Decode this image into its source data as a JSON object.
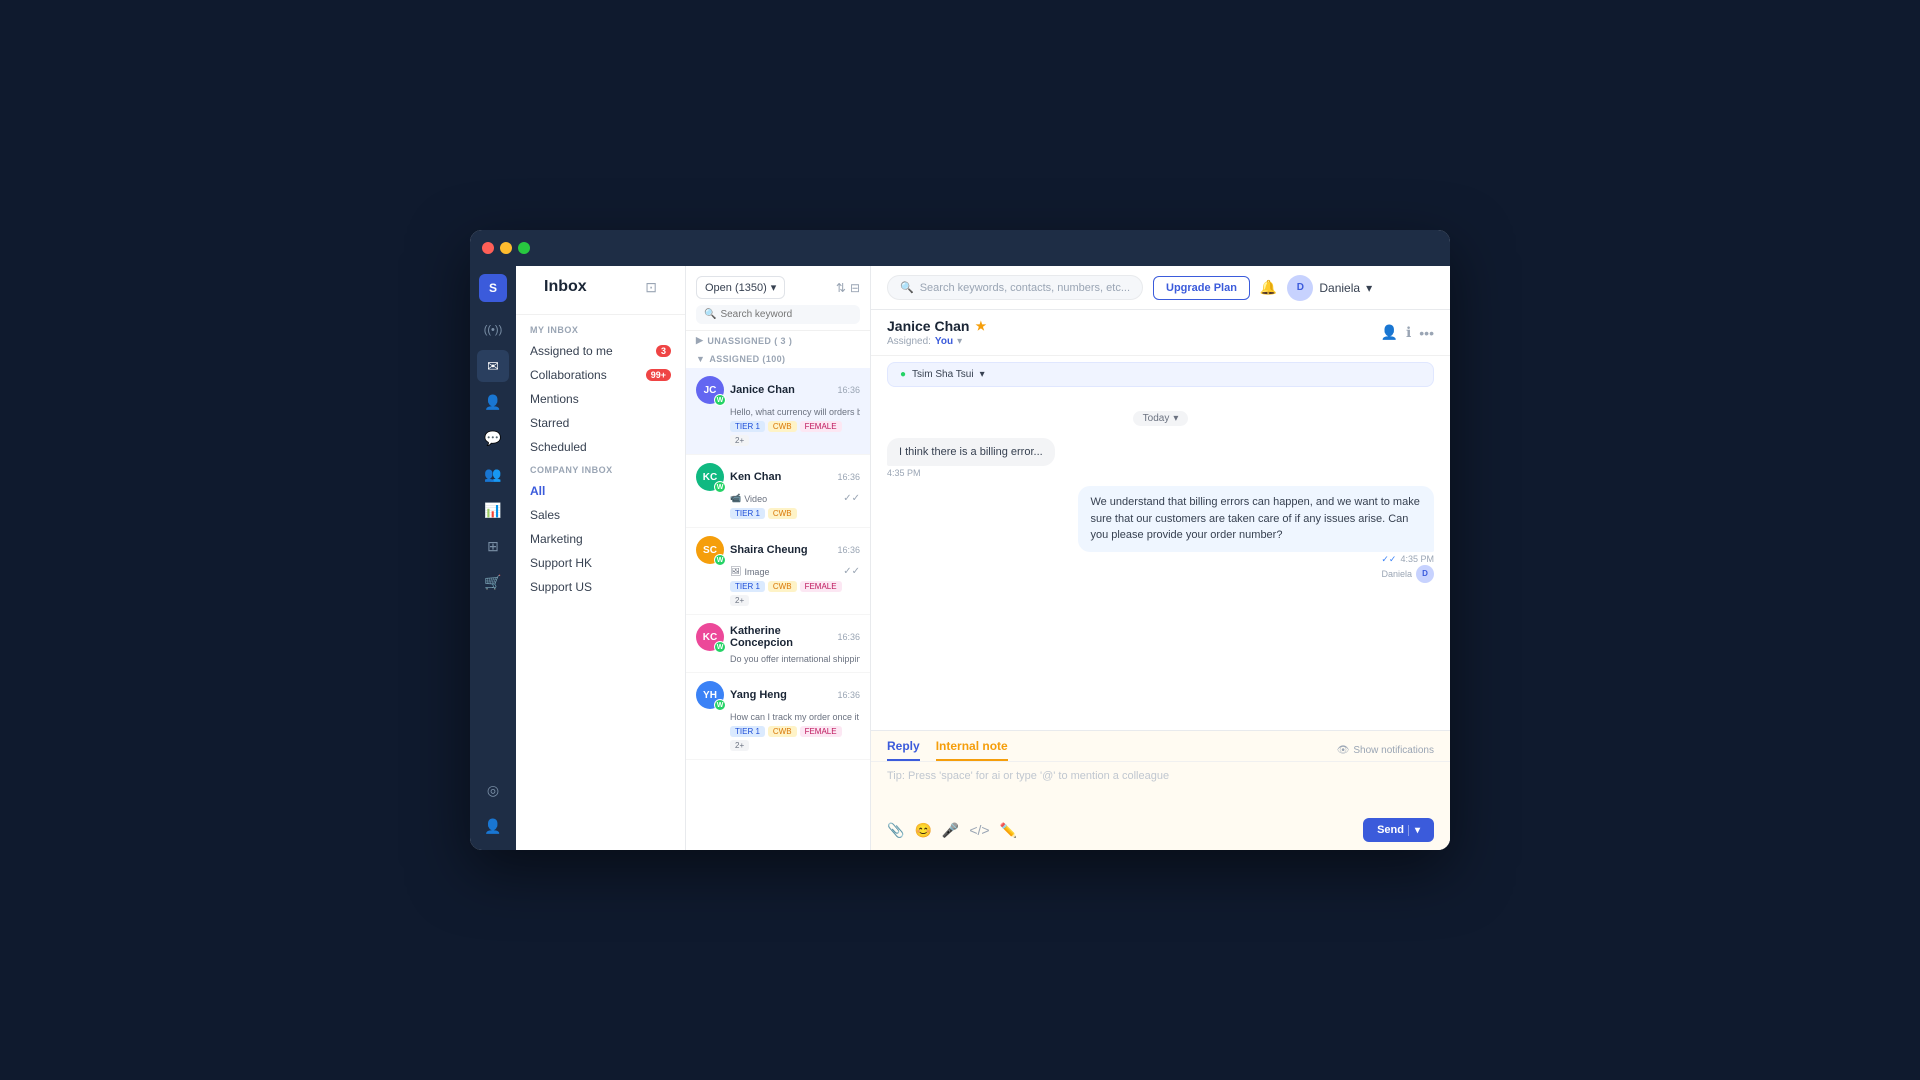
{
  "window": {
    "title": "Inbox"
  },
  "global_header": {
    "search_placeholder": "Search keywords, contacts, numbers, etc...",
    "upgrade_btn": "Upgrade Plan",
    "user_name": "Daniela",
    "bell_icon": "🔔",
    "chevron_icon": "▾"
  },
  "icon_sidebar": {
    "logo": "S",
    "icons": [
      {
        "name": "broadcast-icon",
        "symbol": "((•))",
        "active": false
      },
      {
        "name": "inbox-icon",
        "symbol": "✉",
        "active": true
      },
      {
        "name": "contacts-icon",
        "symbol": "👤",
        "active": false
      },
      {
        "name": "chat-icon",
        "symbol": "💬",
        "active": false
      },
      {
        "name": "team-icon",
        "symbol": "👥",
        "active": false
      },
      {
        "name": "reports-icon",
        "symbol": "📊",
        "active": false
      },
      {
        "name": "settings-icon",
        "symbol": "⚙",
        "active": false
      },
      {
        "name": "shop-icon",
        "symbol": "🛒",
        "active": false
      }
    ],
    "bottom_icons": [
      {
        "name": "circle-icon",
        "symbol": "◎"
      },
      {
        "name": "user-icon",
        "symbol": "👤"
      }
    ]
  },
  "left_panel": {
    "title": "Inbox",
    "my_inbox_label": "MY INBOX",
    "my_inbox_items": [
      {
        "label": "Assigned to me",
        "badge": "3",
        "badge_type": "red"
      },
      {
        "label": "Collaborations",
        "badge": "99+",
        "badge_type": "red"
      },
      {
        "label": "Mentions",
        "badge": null
      },
      {
        "label": "Starred",
        "badge": null
      },
      {
        "label": "Scheduled",
        "badge": null
      }
    ],
    "company_inbox_label": "COMPANY INBOX",
    "company_inbox_items": [
      {
        "label": "All",
        "active": true
      },
      {
        "label": "Sales"
      },
      {
        "label": "Marketing"
      },
      {
        "label": "Support HK"
      },
      {
        "label": "Support US"
      }
    ]
  },
  "conv_panel": {
    "filter_label": "Open (1350)",
    "search_placeholder": "Search keyword",
    "sections": [
      {
        "label": "UNASSIGNED ( 3 )",
        "collapsed": false
      },
      {
        "label": "ASSIGNED (100)",
        "collapsed": false
      }
    ],
    "conversations": [
      {
        "name": "Janice Chan",
        "time": "16:36",
        "preview": "Hello, what currency will orders be settled in?",
        "avatar_color": "#6366f1",
        "avatar_initials": "JC",
        "platform": "whatsapp",
        "tags": [
          "TIER 1",
          "CWB",
          "FEMALE",
          "2+"
        ],
        "active": true
      },
      {
        "name": "Ken Chan",
        "time": "16:36",
        "preview": "Video",
        "avatar_color": "#10b981",
        "avatar_initials": "KC",
        "platform": "whatsapp",
        "tags": [
          "TIER 1",
          "CWB"
        ],
        "active": false
      },
      {
        "name": "Shaira Cheung",
        "time": "16:36",
        "preview": "Image",
        "avatar_color": "#f59e0b",
        "avatar_initials": "SC",
        "platform": "whatsapp",
        "tags": [
          "TIER 1",
          "CWB",
          "FEMALE",
          "2+"
        ],
        "active": false
      },
      {
        "name": "Katherine Concepcion",
        "time": "16:36",
        "preview": "Do you offer international shipping?",
        "avatar_color": "#ec4899",
        "avatar_initials": "KC",
        "platform": "whatsapp",
        "tags": [],
        "active": false
      },
      {
        "name": "Yang Heng",
        "time": "16:36",
        "preview": "How can I track my order once it has been shipped?",
        "avatar_color": "#3b82f6",
        "avatar_initials": "YH",
        "platform": "whatsapp",
        "tags": [
          "TIER 1",
          "CWB",
          "FEMALE",
          "2+"
        ],
        "active": false
      }
    ]
  },
  "chat": {
    "contact_name": "Janice Chan",
    "star": "★",
    "assigned_label": "Assigned:",
    "assigned_to": "You",
    "location": "Tsim Sha Tsui",
    "date_label": "Today",
    "messages": [
      {
        "type": "incoming",
        "text": "I think there is a billing error...",
        "time": "4:35 PM"
      },
      {
        "type": "outgoing",
        "text": "We understand that billing errors can happen, and we want to make sure that our customers are taken care of if any issues arise. Can you please provide your order number?",
        "time": "4:35 PM",
        "agent": "Daniela",
        "read": true
      }
    ],
    "reply_tabs": [
      {
        "label": "Reply",
        "active": "reply"
      },
      {
        "label": "Internal note",
        "active": "note"
      }
    ],
    "active_tab": "note",
    "reply_placeholder": "Tip: Press 'space' for ai or type '@' to mention a colleague",
    "show_notifications_label": "Show notifications",
    "send_btn": "Send",
    "toolbar_icons": [
      "📎",
      "😊",
      "🎤",
      "</>",
      "✏️"
    ]
  }
}
